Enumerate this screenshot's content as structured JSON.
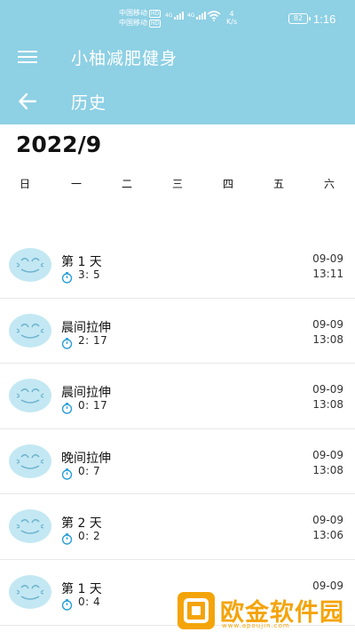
{
  "status_bar": {
    "carrier_1": "中国移动",
    "carrier_2": "中国移动",
    "hd_badge": "HD",
    "network": "4G",
    "speed_value": "4",
    "speed_unit": "K/s",
    "battery": "82",
    "time": "1:16"
  },
  "app_bar": {
    "title": "小柚减肥健身",
    "menu_icon": "menu-icon"
  },
  "sub_bar": {
    "title": "历史",
    "back_icon": "arrow-left-icon"
  },
  "calendar": {
    "month": "2022/9",
    "weekdays": [
      "日",
      "一",
      "二",
      "三",
      "四",
      "五",
      "六"
    ]
  },
  "history": [
    {
      "title": "第 1 天",
      "duration": "3: 5",
      "date": "09-09",
      "time": "13:11"
    },
    {
      "title": "晨间拉伸",
      "duration": "2: 17",
      "date": "09-09",
      "time": "13:08"
    },
    {
      "title": "晨间拉伸",
      "duration": "0: 17",
      "date": "09-09",
      "time": "13:08"
    },
    {
      "title": "晚间拉伸",
      "duration": "0: 7",
      "date": "09-09",
      "time": "13:08"
    },
    {
      "title": "第 2 天",
      "duration": "0: 2",
      "date": "09-09",
      "time": "13:06"
    },
    {
      "title": "第 1 天",
      "duration": "0: 4",
      "date": "09-09",
      "time": ""
    }
  ],
  "watermark": {
    "text": "欧金软件园",
    "url": "www.apoujin.com"
  },
  "colors": {
    "primary": "#8ed0e4",
    "avatar": "#c3e8f3",
    "accent_icon": "#2b9fd6",
    "watermark": "#f4a40b"
  }
}
